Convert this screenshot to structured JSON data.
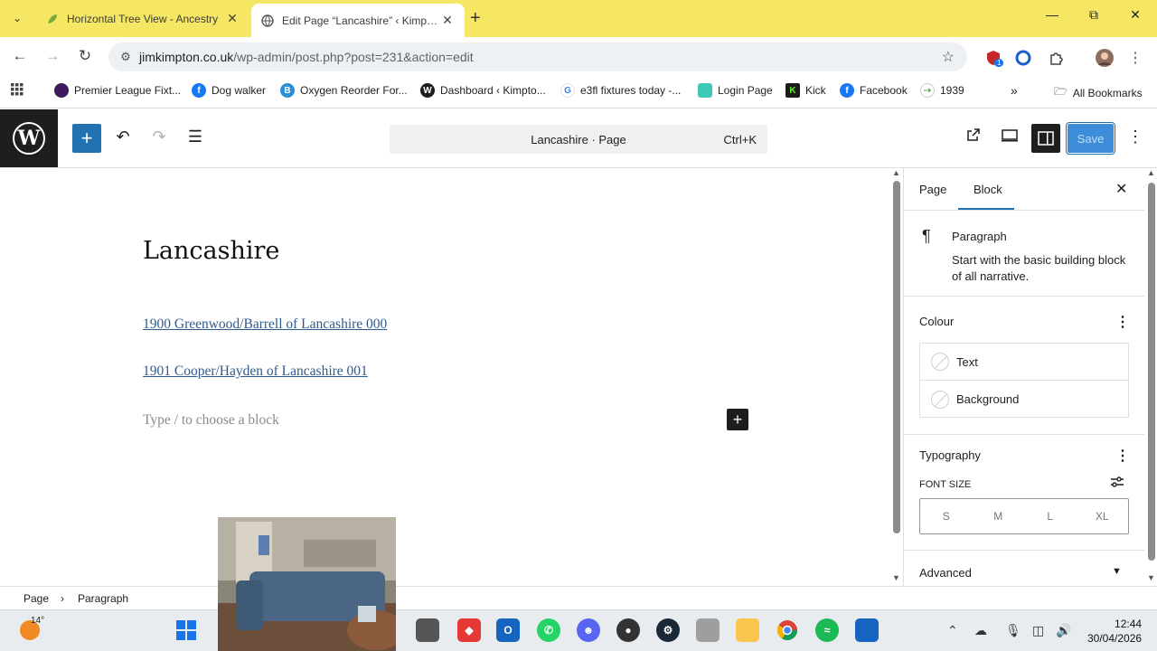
{
  "browser": {
    "tabs": [
      {
        "title": "Horizontal Tree View - Ancestry",
        "active": false
      },
      {
        "title": "Edit Page “Lancashire” ‹ Kimpton",
        "active": true
      }
    ],
    "url_host": "jimkimpton.co.uk",
    "url_path": "/wp-admin/post.php?post=231&action=edit",
    "extension_badge": "1",
    "bookmarks": [
      {
        "label": "Premier League Fixt...",
        "icon": "premier-league-icon",
        "color": "#3d195b"
      },
      {
        "label": "Dog walker",
        "icon": "facebook-icon",
        "color": "#1877f2"
      },
      {
        "label": "Oxygen Reorder For...",
        "icon": "oxygen-icon",
        "color": "#2a8fd6"
      },
      {
        "label": "Dashboard ‹ Kimpto...",
        "icon": "wordpress-icon",
        "color": "#1e1e1e"
      },
      {
        "label": "e3fl fixtures today -...",
        "icon": "google-icon",
        "color": "#4285f4"
      },
      {
        "label": "Login Page",
        "icon": "login-icon",
        "color": "#3fc8b2"
      },
      {
        "label": "Kick",
        "icon": "kick-icon",
        "color": "#1a1a1a"
      },
      {
        "label": "Facebook",
        "icon": "facebook-icon",
        "color": "#1877f2"
      },
      {
        "label": "1939",
        "icon": "findmypast-icon",
        "color": "#6aa84f"
      }
    ],
    "all_bookmarks": "All Bookmarks"
  },
  "editor": {
    "command_bar": "Lancashire · Page",
    "command_shortcut": "Ctrl+K",
    "save_label": "Save"
  },
  "content": {
    "title": "Lancashire",
    "links": [
      "1900 Greenwood/Barrell of Lancashire 000",
      "1901 Cooper/Hayden of Lancashire 001"
    ],
    "placeholder": "Type / to choose a block"
  },
  "sidebar": {
    "tabs": [
      "Page",
      "Block"
    ],
    "active_tab": "Block",
    "block_name": "Paragraph",
    "block_description": "Start with the basic building block of all narrative.",
    "colour": {
      "heading": "Colour",
      "options": [
        "Text",
        "Background"
      ]
    },
    "typography": {
      "heading": "Typography",
      "font_size_label": "FONT SIZE",
      "sizes": [
        "S",
        "M",
        "L",
        "XL"
      ]
    },
    "advanced": "Advanced"
  },
  "breadcrumbs": [
    "Page",
    "Paragraph"
  ],
  "taskbar": {
    "temperature": "14°",
    "time": "12:44",
    "date": "30/04/2026"
  }
}
